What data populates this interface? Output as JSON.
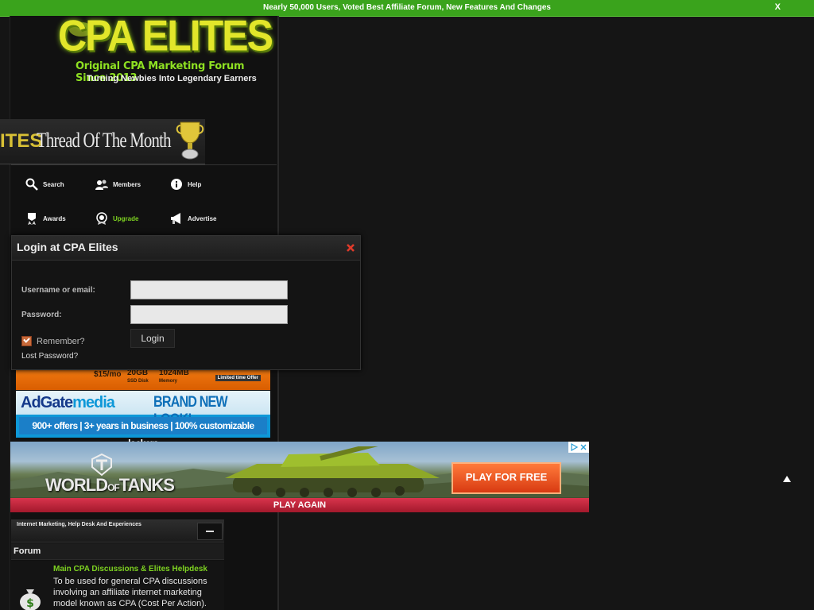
{
  "notice": {
    "text": "Nearly 50,000 Users, Voted Best Affiliate Forum, New Features And Changes",
    "close": "X"
  },
  "logo": {
    "title": "CPA ELITES",
    "tagline": "Original CPA Marketing Forum Since 2013",
    "subtitle": "Turning Newbies Into Legendary Earners"
  },
  "thread_of_month": {
    "tag": "ITES",
    "text": "Thread Of The Month"
  },
  "nav": {
    "search": "Search",
    "members": "Members",
    "help": "Help",
    "awards": "Awards",
    "upgrade": "Upgrade",
    "advertise": "Advertise"
  },
  "login": {
    "title": "Login at CPA Elites",
    "username_label": "Username or email:",
    "password_label": "Password:",
    "remember_label": "Remember?",
    "login_button": "Login",
    "lost_password": "Lost Password?"
  },
  "ads": {
    "host_price": "$15/mo",
    "host_ssd": "20GB",
    "host_ssd_label": "SSD Disk",
    "host_mem": "1024MB",
    "host_mem_label": "Memory",
    "host_offer": "Limited time Offer",
    "adgate_logo_a": "AdGate",
    "adgate_logo_b": "media",
    "adgate_brand": "BRAND NEW LOOK!",
    "adgate_bar": "900+ offers | 3+ years in business | 100% customizable lockers",
    "wot_logo": "WORLD",
    "wot_logo_of": "OF",
    "wot_logo_tanks": "TANKS",
    "wot_play": "PLAY FOR FREE",
    "wot_again": "PLAY AGAIN"
  },
  "forum": {
    "category_title": "Internet Marketing, Help Desk And Experiences",
    "column_header": "Forum",
    "rows": [
      {
        "title": "Main CPA Discussions & Elites Helpdesk",
        "description": "To be used for general CPA discussions involving an affiliate internet marketing model known as CPA (Cost Per Action)."
      }
    ]
  },
  "colors": {
    "accent_green": "#7ed321",
    "notice_bar": "#3aa31c",
    "background": "#151515"
  }
}
